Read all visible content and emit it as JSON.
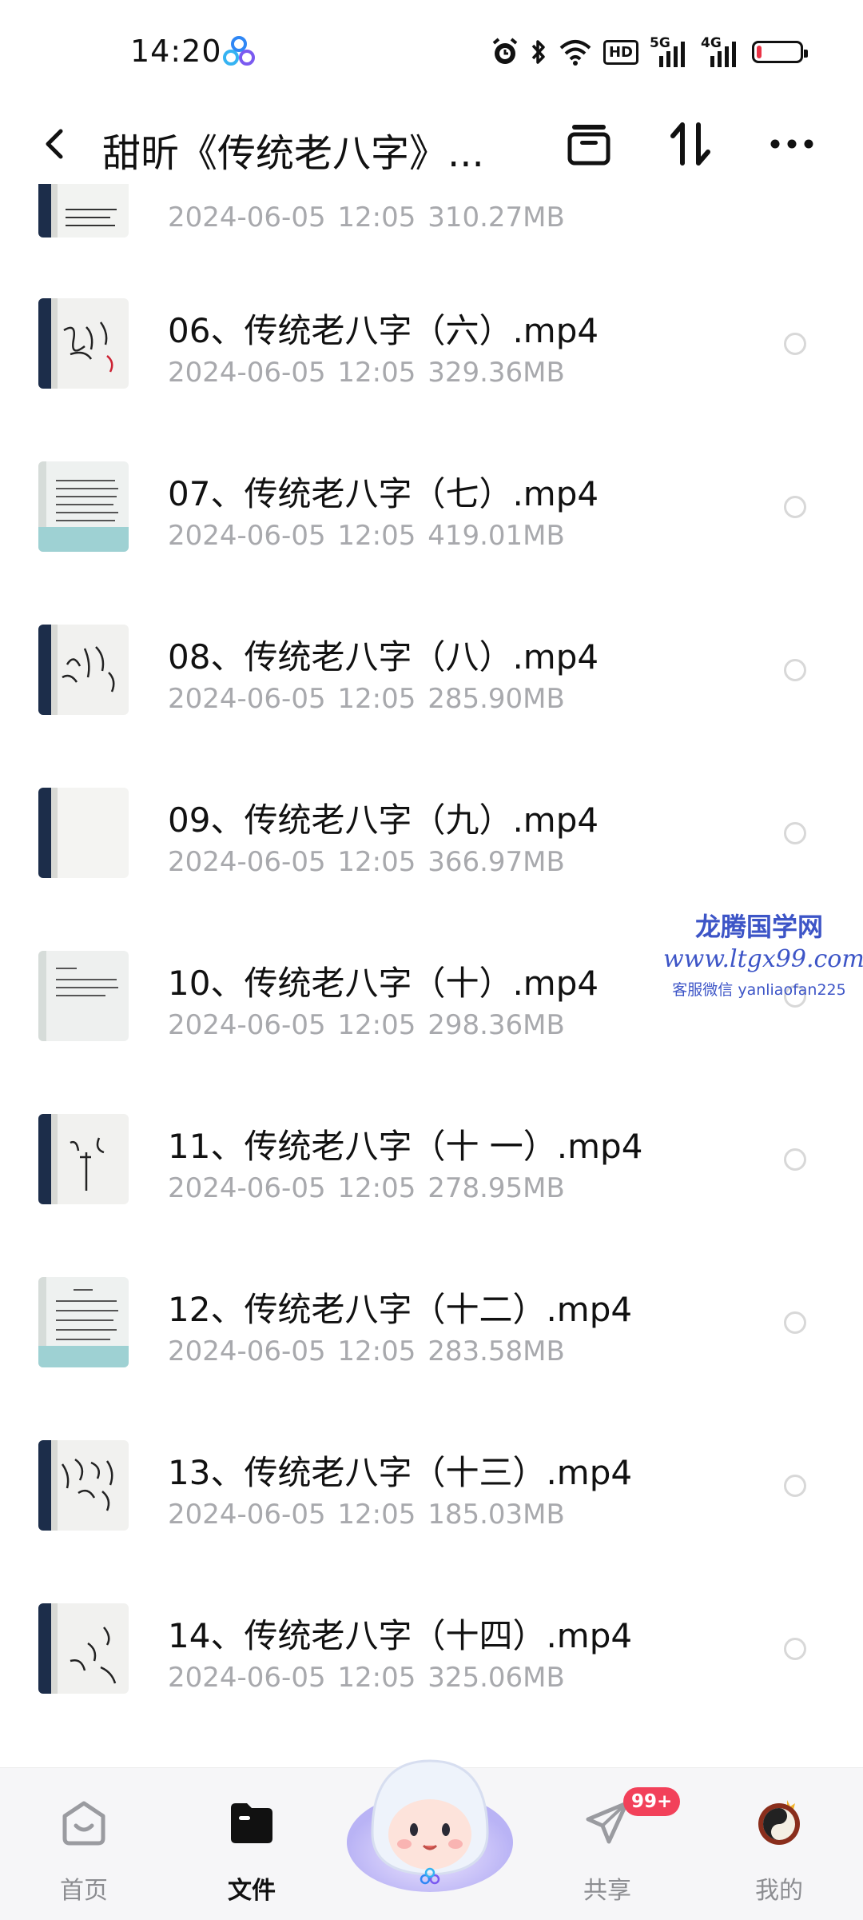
{
  "status_bar": {
    "time": "14:20",
    "network_left": "5G",
    "network_right": "4G",
    "hd_label": "HD",
    "battery_percent": 12,
    "battery_color": "#ea3447"
  },
  "header": {
    "title": "甜昕《传统老八字》...",
    "back_icon": "chevron-left-icon",
    "actions": [
      "archive-icon",
      "sort-icon",
      "more-icon"
    ]
  },
  "files": [
    {
      "name": "",
      "date": "2024-06-05  12:05",
      "size": "310.27MB"
    },
    {
      "name": "06、传统老八字（六）.mp4",
      "date": "2024-06-05  12:05",
      "size": "329.36MB"
    },
    {
      "name": "07、传统老八字（七）.mp4",
      "date": "2024-06-05  12:05",
      "size": "419.01MB"
    },
    {
      "name": "08、传统老八字（八）.mp4",
      "date": "2024-06-05  12:05",
      "size": "285.90MB"
    },
    {
      "name": "09、传统老八字（九）.mp4",
      "date": "2024-06-05  12:05",
      "size": "366.97MB"
    },
    {
      "name": "10、传统老八字（十）.mp4",
      "date": "2024-06-05  12:05",
      "size": "298.36MB"
    },
    {
      "name": "11、传统老八字（十 一）.mp4",
      "date": "2024-06-05  12:05",
      "size": "278.95MB"
    },
    {
      "name": "12、传统老八字（十二）.mp4",
      "date": "2024-06-05  12:05",
      "size": "283.58MB"
    },
    {
      "name": "13、传统老八字（十三）.mp4",
      "date": "2024-06-05  12:05",
      "size": "185.03MB"
    },
    {
      "name": "14、传统老八字（十四）.mp4",
      "date": "2024-06-05  12:05",
      "size": "325.06MB"
    }
  ],
  "watermark": {
    "line1": "龙腾国学网",
    "line2": "www.ltgx99.com",
    "line3": "客服微信 yanliaofan225"
  },
  "bottom_nav": {
    "tabs": [
      {
        "label": "首页",
        "icon": "home-icon",
        "active": false
      },
      {
        "label": "文件",
        "icon": "folder-icon",
        "active": true
      },
      {
        "label": "共享",
        "icon": "share-plane-icon",
        "active": false,
        "badge": "99+"
      },
      {
        "label": "我的",
        "icon": "avatar-icon",
        "active": false
      }
    ]
  }
}
